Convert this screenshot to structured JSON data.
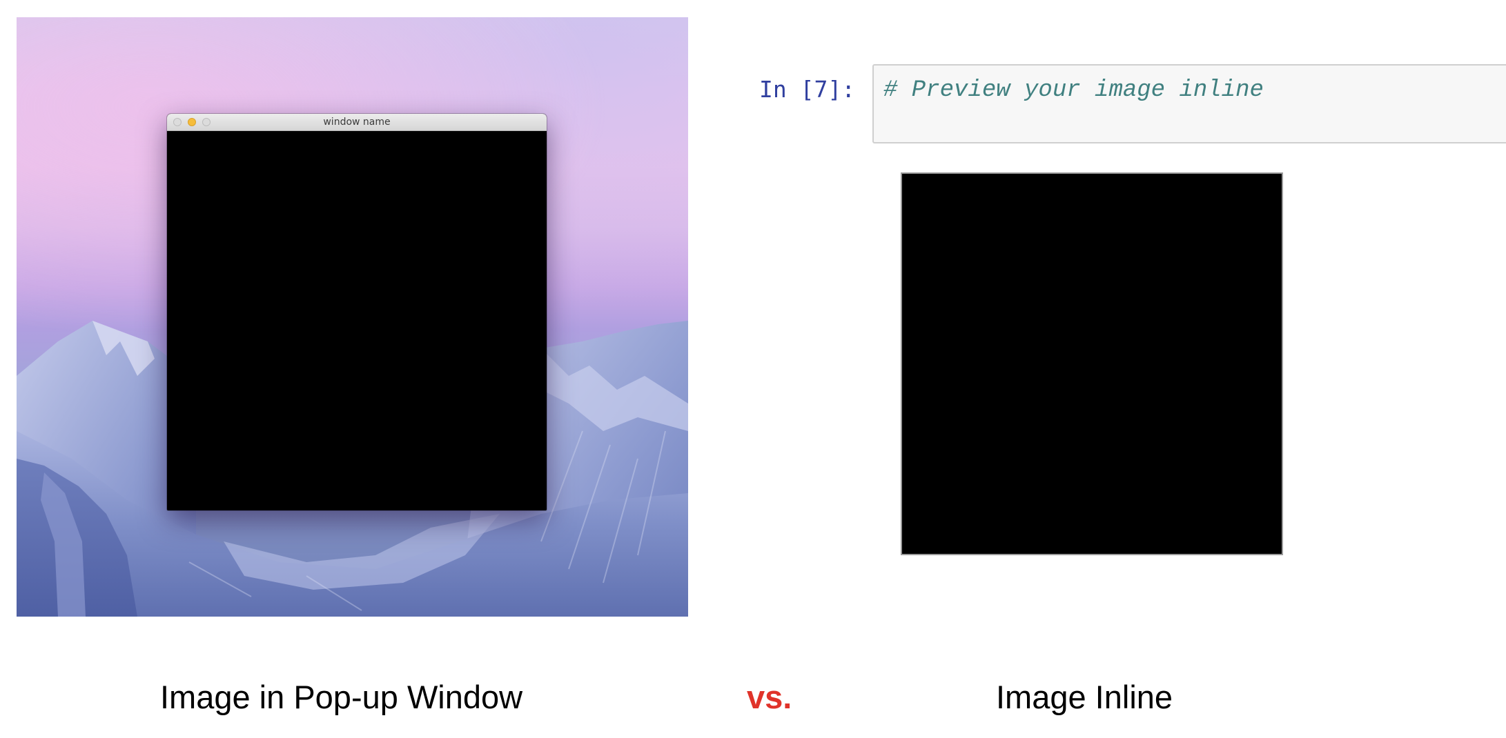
{
  "left_panel": {
    "popup_window": {
      "title": "window name",
      "buttons": [
        "close-icon",
        "minimize-icon",
        "zoom-icon"
      ]
    }
  },
  "right_panel": {
    "prompt": "In [7]:",
    "code": "# Preview your image inline"
  },
  "captions": {
    "left": "Image in Pop-up Window",
    "vs": "vs.",
    "right": "Image Inline"
  },
  "colors": {
    "prompt": "#303f9f",
    "comment": "#408080",
    "vs": "#e0332a",
    "minimize_button": "#f6bd3b"
  }
}
